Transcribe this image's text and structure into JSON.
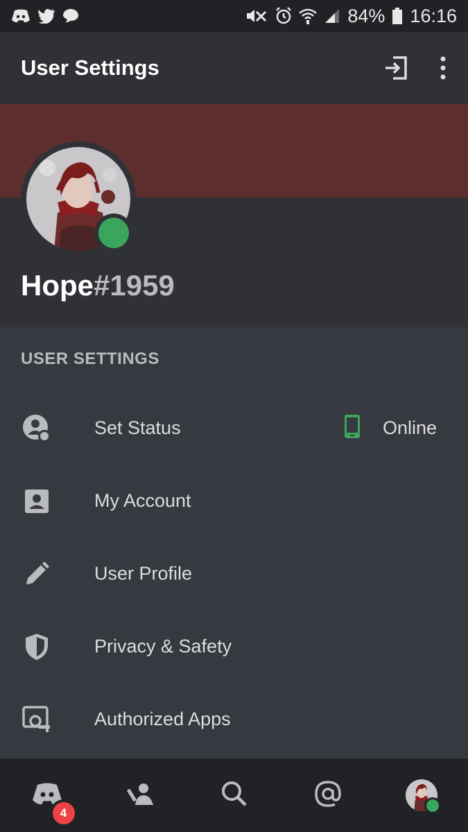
{
  "status_bar": {
    "left_icons": [
      "discord-icon",
      "twitter-icon",
      "chat-bubble-icon"
    ],
    "right_icons": [
      "nfc-mute-icon",
      "alarm-icon",
      "wifi-icon",
      "signal-icon",
      "battery-icon"
    ],
    "battery": "84%",
    "time": "16:16"
  },
  "header": {
    "title": "User Settings",
    "actions": [
      "logout-icon",
      "more-vertical-icon"
    ]
  },
  "profile": {
    "username": "Hope",
    "discriminator": "#1959",
    "banner_color": "#5c2e2e",
    "status_color": "#3ba55c"
  },
  "section": {
    "title": "USER SETTINGS"
  },
  "settings_items": [
    {
      "label": "Set Status",
      "icon": "status-icon",
      "trailing": "Online",
      "trailing_icon": "mobile-phone-icon"
    },
    {
      "label": "My Account",
      "icon": "account-card-icon"
    },
    {
      "label": "User Profile",
      "icon": "pencil-icon"
    },
    {
      "label": "Privacy & Safety",
      "icon": "shield-icon"
    },
    {
      "label": "Authorized Apps",
      "icon": "authorized-apps-icon"
    }
  ],
  "bottom_nav": {
    "items": [
      "discord-home-icon",
      "friends-icon",
      "search-icon",
      "mentions-icon",
      "profile-avatar"
    ],
    "badge": "4"
  },
  "colors": {
    "background": "#36393f",
    "header": "#2f3136",
    "nav": "#202225",
    "online": "#3ba55c",
    "badge": "#ed4245"
  }
}
